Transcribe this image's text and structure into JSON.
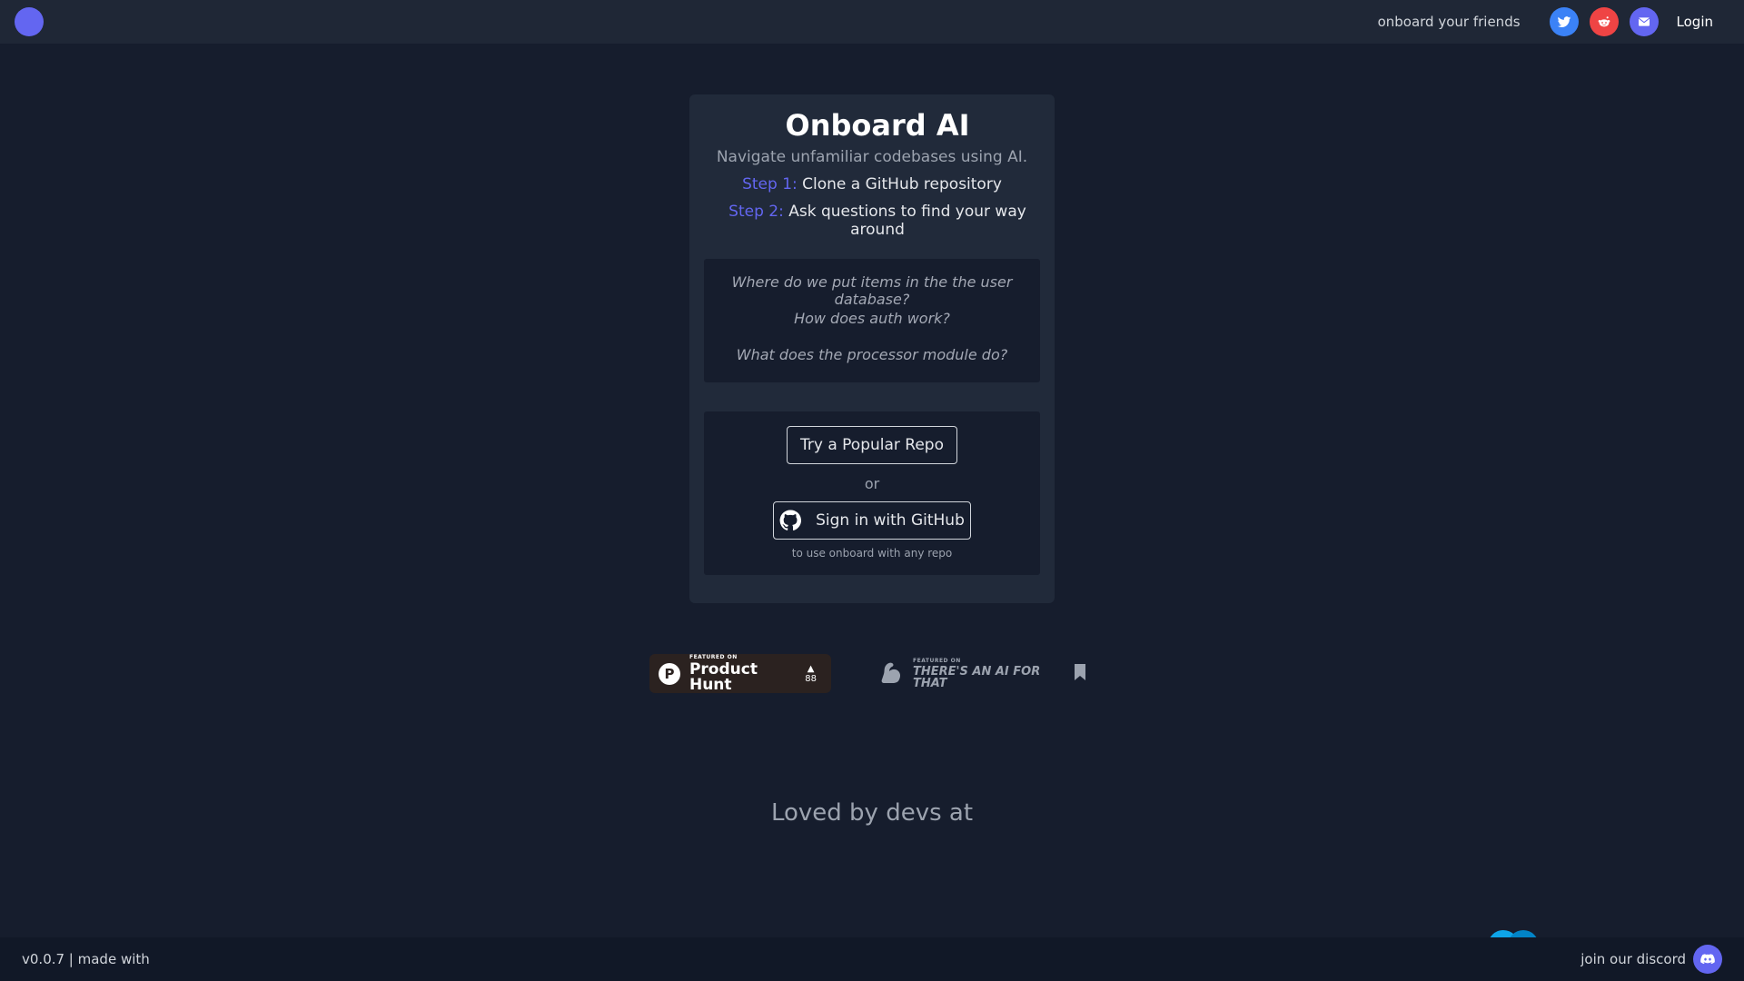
{
  "topbar": {
    "onboard_friends": "onboard your friends",
    "share_icons": [
      "twitter-icon",
      "reddit-icon",
      "email-icon"
    ],
    "login": "Login"
  },
  "card": {
    "title": "Onboard AI",
    "subtitle": "Navigate unfamiliar codebases using AI.",
    "step1_label": "Step 1:",
    "step1_text": "Clone a GitHub repository",
    "step2_label": "Step 2:",
    "step2_text": "Ask questions to find your way around",
    "examples": [
      "Where do we put items in the the user database?",
      "How does auth work?",
      "What does the processor module do?"
    ],
    "popular_repo_button": "Try a Popular Repo",
    "or": "or",
    "github_button": "Sign in with GitHub",
    "github_note": "to use onboard with any repo"
  },
  "badges": {
    "producthunt": {
      "logo_letter": "P",
      "small": "FEATURED ON",
      "big": "Product Hunt",
      "arrow": "▲",
      "votes": "88"
    },
    "taaft": {
      "small": "FEATURED ON",
      "big": "THERE'S AN AI FOR THAT"
    }
  },
  "loved": "Loved by devs at",
  "footer": {
    "version": "v0.0.7 | made with",
    "discord": "join our discord"
  },
  "colors": {
    "background": "#161d2d",
    "card": "#212a3a",
    "accent": "#6366f1",
    "twitter": "#3b82f6",
    "reddit": "#ef4444"
  }
}
